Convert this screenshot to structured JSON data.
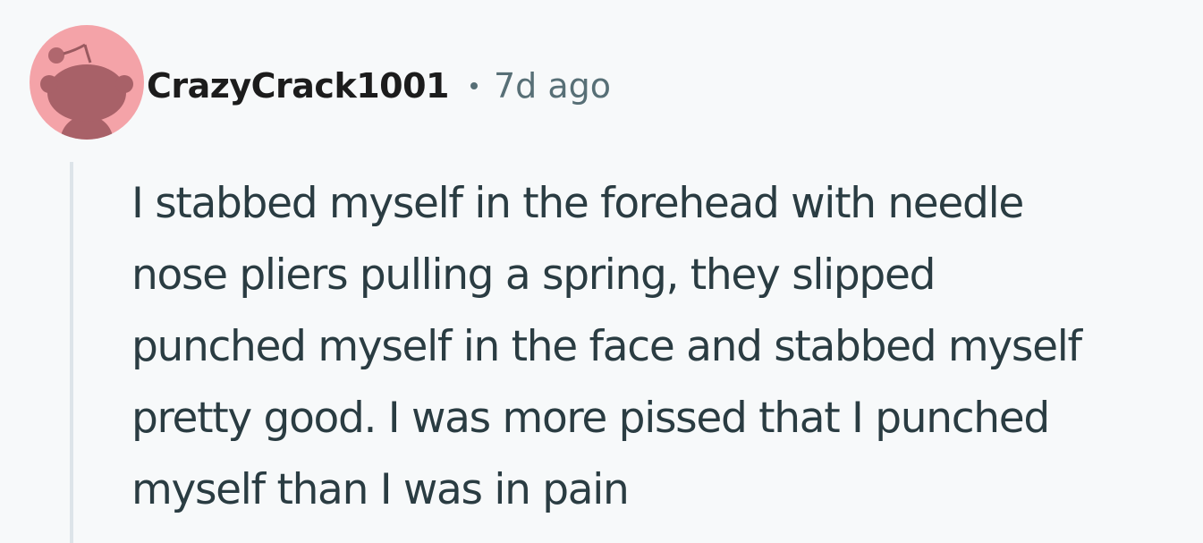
{
  "comment": {
    "avatar_icon": "reddit-snoo-avatar-icon",
    "username": "CrazyCrack1001",
    "separator": "•",
    "timestamp": "7d ago",
    "body_lines": [
      "I stabbed myself in the forehead with needle",
      "nose pliers pulling a spring, they slipped",
      "punched myself in the face and stabbed myself",
      "pretty good. I was more pissed that I punched",
      "myself than I was in pain"
    ]
  },
  "colors": {
    "background": "#f7f9fa",
    "avatar_bg": "#f4a3a8",
    "avatar_figure": "#a86168",
    "username": "#1c1c1c",
    "meta_text": "#576f76",
    "body_text": "#2a3c42",
    "thread_line": "#dde4e9"
  }
}
